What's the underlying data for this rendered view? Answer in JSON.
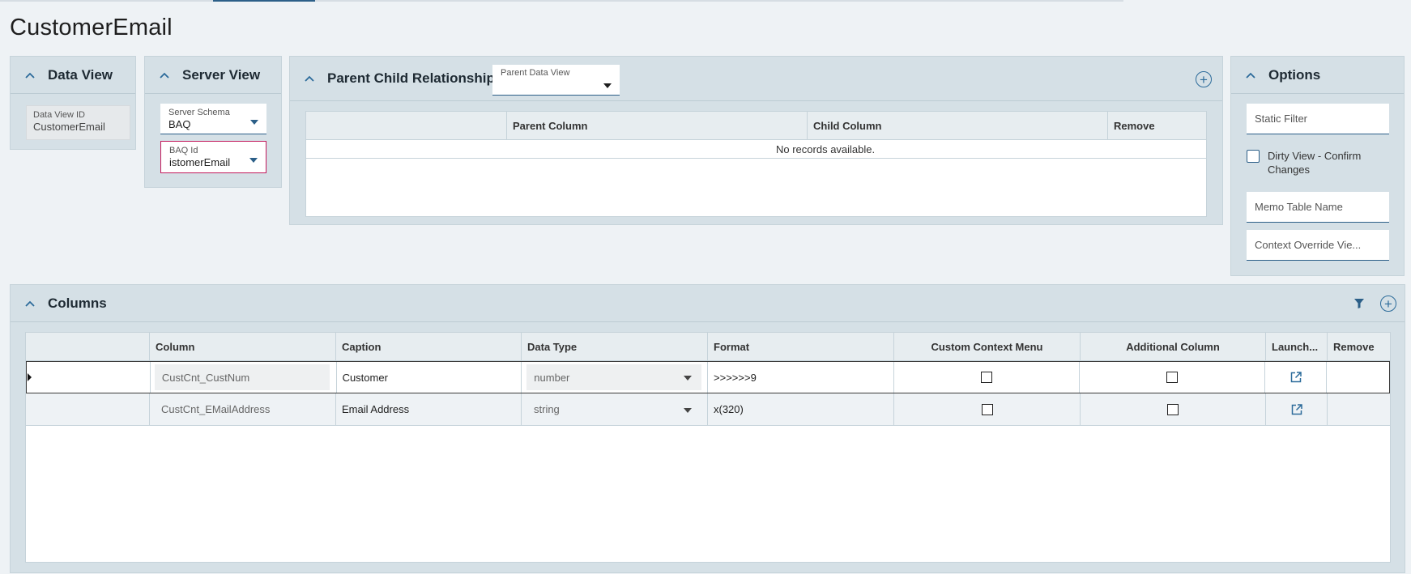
{
  "page": {
    "title": "CustomerEmail"
  },
  "data_view": {
    "title": "Data View",
    "field_label": "Data View ID",
    "field_value": "CustomerEmail"
  },
  "server_view": {
    "title": "Server View",
    "schema_label": "Server Schema",
    "schema_value": "BAQ",
    "baq_label": "BAQ Id",
    "baq_value": "istomerEmail"
  },
  "parent_child": {
    "title": "Parent Child Relationships",
    "parent_data_view_label": "Parent Data View",
    "columns": [
      "",
      "Parent Column",
      "Child Column",
      "Remove"
    ],
    "empty_text": "No records available."
  },
  "options": {
    "title": "Options",
    "static_filter_placeholder": "Static Filter",
    "dirty_view_label": "Dirty View - Confirm Changes",
    "memo_table_placeholder": "Memo Table Name",
    "context_override_placeholder": "Context Override Vie..."
  },
  "columns_panel": {
    "title": "Columns",
    "headers": [
      "",
      "Column",
      "Caption",
      "Data Type",
      "Format",
      "Custom Context Menu",
      "Additional Column",
      "Launch...",
      "Remove"
    ],
    "rows": [
      {
        "column": "CustCnt_CustNum",
        "caption": "Customer",
        "data_type": "number",
        "format": ">>>>>>9",
        "custom_context_menu": false,
        "additional_column": false,
        "selected": true
      },
      {
        "column": "CustCnt_EMailAddress",
        "caption": "Email Address",
        "data_type": "string",
        "format": "x(320)",
        "custom_context_menu": false,
        "additional_column": false,
        "selected": false
      }
    ]
  },
  "colors": {
    "accent": "#2c5f88",
    "panel_bg": "#d5e0e6",
    "error_border": "#c2185b"
  }
}
